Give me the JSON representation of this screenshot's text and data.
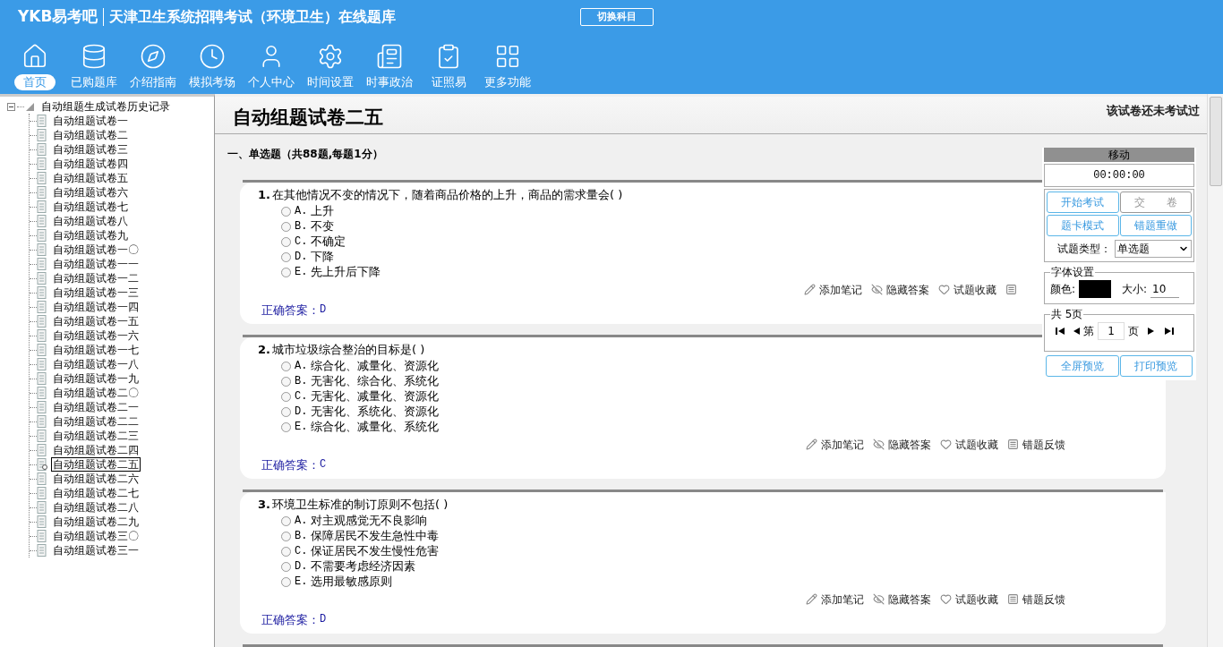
{
  "header": {
    "logo": "YKB易考吧",
    "title": "天津卫生系统招聘考试（环境卫生）在线题库",
    "switch_button": "切换科目"
  },
  "nav": [
    {
      "kind": "home",
      "label": "首页",
      "selected": true
    },
    {
      "kind": "database",
      "label": "已购题库",
      "selected": false
    },
    {
      "kind": "compass",
      "label": "介绍指南",
      "selected": false
    },
    {
      "kind": "clock",
      "label": "模拟考场",
      "selected": false
    },
    {
      "kind": "user",
      "label": "个人中心",
      "selected": false
    },
    {
      "kind": "gear",
      "label": "时间设置",
      "selected": false
    },
    {
      "kind": "news",
      "label": "时事政治",
      "selected": false
    },
    {
      "kind": "checklist",
      "label": "证照易",
      "selected": false
    },
    {
      "kind": "grid",
      "label": "更多功能",
      "selected": false
    }
  ],
  "tree": {
    "label": "自动组题生成试卷历史记录",
    "expanded": true,
    "children": [
      {
        "label": "自动组题试卷一",
        "selected": false
      },
      {
        "label": "自动组题试卷二",
        "selected": false
      },
      {
        "label": "自动组题试卷三",
        "selected": false
      },
      {
        "label": "自动组题试卷四",
        "selected": false
      },
      {
        "label": "自动组题试卷五",
        "selected": false
      },
      {
        "label": "自动组题试卷六",
        "selected": false
      },
      {
        "label": "自动组题试卷七",
        "selected": false
      },
      {
        "label": "自动组题试卷八",
        "selected": false
      },
      {
        "label": "自动组题试卷九",
        "selected": false
      },
      {
        "label": "自动组题试卷一〇",
        "selected": false
      },
      {
        "label": "自动组题试卷一一",
        "selected": false
      },
      {
        "label": "自动组题试卷一二",
        "selected": false
      },
      {
        "label": "自动组题试卷一三",
        "selected": false
      },
      {
        "label": "自动组题试卷一四",
        "selected": false
      },
      {
        "label": "自动组题试卷一五",
        "selected": false
      },
      {
        "label": "自动组题试卷一六",
        "selected": false
      },
      {
        "label": "自动组题试卷一七",
        "selected": false
      },
      {
        "label": "自动组题试卷一八",
        "selected": false
      },
      {
        "label": "自动组题试卷一九",
        "selected": false
      },
      {
        "label": "自动组题试卷二〇",
        "selected": false
      },
      {
        "label": "自动组题试卷二一",
        "selected": false
      },
      {
        "label": "自动组题试卷二二",
        "selected": false
      },
      {
        "label": "自动组题试卷二三",
        "selected": false
      },
      {
        "label": "自动组题试卷二四",
        "selected": false
      },
      {
        "label": "自动组题试卷二五",
        "selected": true
      },
      {
        "label": "自动组题试卷二六",
        "selected": false
      },
      {
        "label": "自动组题试卷二七",
        "selected": false
      },
      {
        "label": "自动组题试卷二八",
        "selected": false
      },
      {
        "label": "自动组题试卷二九",
        "selected": false
      },
      {
        "label": "自动组题试卷三〇",
        "selected": false
      },
      {
        "label": "自动组题试卷三一",
        "selected": false
      }
    ]
  },
  "paper": {
    "title": "自动组题试卷二五",
    "status": "该试卷还未考试过",
    "section": "一、单选题（共88题,每题1分）",
    "questions": [
      {
        "number": "1.",
        "text": "在其他情况不变的情况下，随着商品价格的上升，商品的需求量会( )",
        "options": [
          {
            "label": "A.",
            "text": "上升",
            "selected": false
          },
          {
            "label": "B.",
            "text": "不变",
            "selected": false
          },
          {
            "label": "C.",
            "text": "不确定",
            "selected": false
          },
          {
            "label": "D.",
            "text": "下降",
            "selected": false
          },
          {
            "label": "E.",
            "text": "先上升后下降",
            "selected": false
          }
        ],
        "answer_label": "正确答案：",
        "answer": "D",
        "actions": [
          {
            "kind": "note",
            "label": "添加笔记"
          },
          {
            "kind": "hide",
            "label": "隐藏答案"
          },
          {
            "kind": "favorite",
            "label": "试题收藏"
          },
          {
            "kind": "report"
          }
        ]
      },
      {
        "number": "2.",
        "text": "城市垃圾综合整治的目标是( )",
        "options": [
          {
            "label": "A.",
            "text": "综合化、减量化、资源化",
            "selected": false
          },
          {
            "label": "B.",
            "text": "无害化、综合化、系统化",
            "selected": false
          },
          {
            "label": "C.",
            "text": "无害化、减量化、资源化",
            "selected": false
          },
          {
            "label": "D.",
            "text": "无害化、系统化、资源化",
            "selected": false
          },
          {
            "label": "E.",
            "text": "综合化、减量化、系统化",
            "selected": false
          }
        ],
        "answer_label": "正确答案：",
        "answer": "C",
        "actions": [
          {
            "kind": "note",
            "label": "添加笔记"
          },
          {
            "kind": "hide",
            "label": "隐藏答案"
          },
          {
            "kind": "favorite",
            "label": "试题收藏"
          },
          {
            "kind": "report",
            "label": "错题反馈"
          }
        ]
      },
      {
        "number": "3.",
        "text": "环境卫生标准的制订原则不包括( )",
        "options": [
          {
            "label": "A.",
            "text": "对主观感觉无不良影响",
            "selected": false
          },
          {
            "label": "B.",
            "text": "保障居民不发生急性中毒",
            "selected": false
          },
          {
            "label": "C.",
            "text": "保证居民不发生慢性危害",
            "selected": false
          },
          {
            "label": "D.",
            "text": "不需要考虑经济因素",
            "selected": false
          },
          {
            "label": "E.",
            "text": "选用最敏感原则",
            "selected": false
          }
        ],
        "answer_label": "正确答案：",
        "answer": "D",
        "actions": [
          {
            "kind": "note",
            "label": "添加笔记"
          },
          {
            "kind": "hide",
            "label": "隐藏答案"
          },
          {
            "kind": "favorite",
            "label": "试题收藏"
          },
          {
            "kind": "report",
            "label": "错题反馈"
          }
        ]
      }
    ]
  },
  "panel": {
    "handle": "移动",
    "timer": "00:00:00",
    "buttons": [
      {
        "label": "开始考试",
        "disabled": false
      },
      {
        "label": "交　　卷",
        "disabled": true
      },
      {
        "label": "题卡模式",
        "disabled": false
      },
      {
        "label": "错题重做",
        "disabled": false
      }
    ],
    "type_label": "试题类型：",
    "type_value": "单选题",
    "font_group": "字体设置",
    "color_label": "颜色:",
    "color": "#000000",
    "size_label": "大小:",
    "size_value": "10",
    "pages_group": "共 5页",
    "page_prefix": "第",
    "page_value": "1",
    "page_suffix": "页",
    "bottom_buttons": [
      {
        "label": "全屏预览",
        "disabled": false
      },
      {
        "label": "打印预览",
        "disabled": false
      }
    ]
  }
}
